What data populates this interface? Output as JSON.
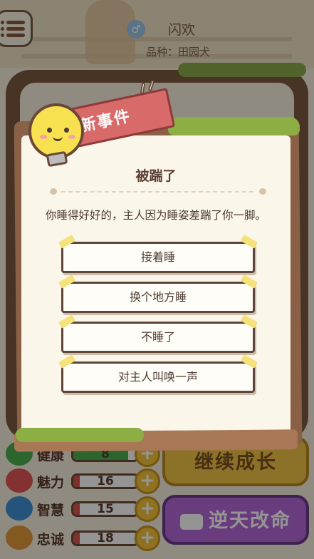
{
  "pet": {
    "name": "闪欢",
    "breed": "品种：田园犬",
    "gender_icon": "male-icon"
  },
  "stats": [
    {
      "label": "健康",
      "value": "8",
      "icon": "health-icon",
      "fill": 0.85,
      "color": "#4caf50"
    },
    {
      "label": "魅力",
      "value": "16",
      "icon": "heart-icon",
      "fill": 0.1,
      "color": "#e25555"
    },
    {
      "label": "智慧",
      "value": "15",
      "icon": "brain-icon",
      "fill": 0.1,
      "color": "#3f8fd6"
    },
    {
      "label": "忠诚",
      "value": "18",
      "icon": "paw-icon",
      "fill": 0.1,
      "color": "#e29a3a"
    }
  ],
  "buttons": {
    "grow": "继续成长",
    "revive": "逆天改命"
  },
  "event": {
    "badge": "新事件",
    "title": "被踹了",
    "text": "你睡得好好的，主人因为睡姿差踹了你一脚。",
    "options": [
      "接着睡",
      "换个地方睡",
      "不睡了",
      "对主人叫唤一声"
    ]
  }
}
